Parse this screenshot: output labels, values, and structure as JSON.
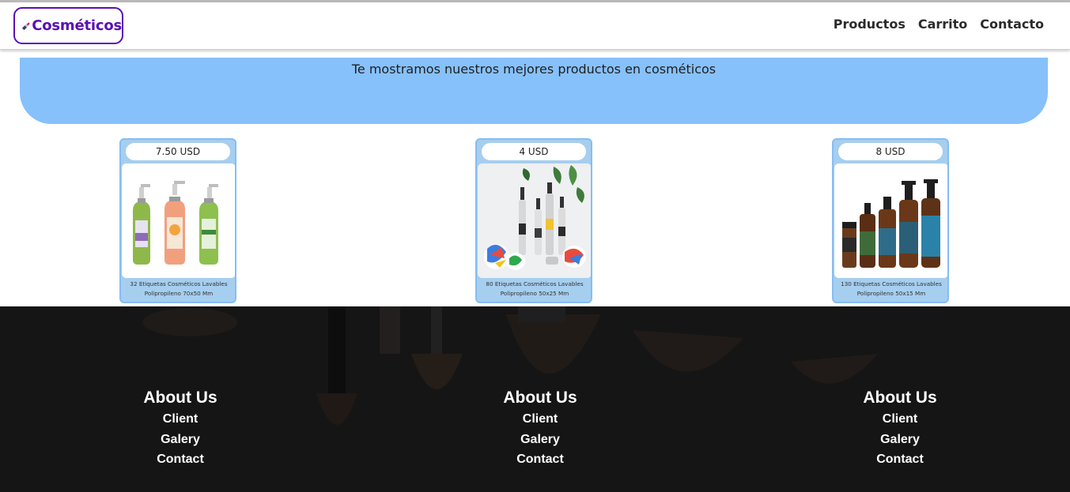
{
  "header": {
    "brand": "Cosméticos",
    "nav": [
      "Productos",
      "Carrito",
      "Contacto"
    ]
  },
  "hero": {
    "text": "Te mostramos nuestros mejores productos en cosméticos"
  },
  "products": [
    {
      "price": "7.50 USD",
      "title": "32 Etiquetas Cosméticos Lavables Polipropileno 70x50 Mm",
      "image": "hand-soap-bottles"
    },
    {
      "price": "4 USD",
      "title": "80 Etiquetas Cosméticos Lavables Polipropileno 50x25 Mm",
      "image": "cosmetic-bottles-set"
    },
    {
      "price": "8 USD",
      "title": "130 Etiquetas Cosméticos Lavables Polipropileno 50x15 Mm",
      "image": "amber-bottles"
    }
  ],
  "footer": {
    "columns": [
      {
        "heading": "About Us",
        "links": [
          "Client",
          "Galery",
          "Contact"
        ]
      },
      {
        "heading": "About Us",
        "links": [
          "Client",
          "Galery",
          "Contact"
        ]
      },
      {
        "heading": "About Us",
        "links": [
          "Client",
          "Galery",
          "Contact"
        ]
      }
    ]
  },
  "colors": {
    "brand": "#5b0fb5",
    "hero": "#87c1fb",
    "card": "#a6ceef",
    "footer": "#1b1b1b"
  }
}
